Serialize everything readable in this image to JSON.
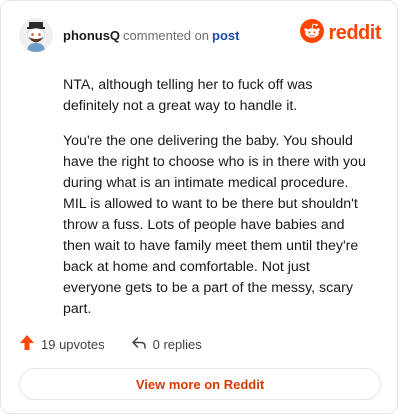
{
  "header": {
    "username": "phonusQ",
    "action_text": "commented on",
    "post_link": "post",
    "brand_name": "reddit",
    "avatar_icon": "snoo-avatar-icon",
    "brand_icon": "reddit-logo-icon"
  },
  "comment": {
    "paragraphs": [
      "NTA, although telling her to fuck off was definitely not a great way to handle it.",
      "You're the one delivering the baby. You should have the right to choose who is in there with you during what is an intimate medical procedure. MIL is allowed to want to be there but shouldn't throw a fuss. Lots of people have babies and then wait to have family meet them until they're back at home and comfortable. Not just everyone gets to be a part of the messy, scary part."
    ]
  },
  "stats": {
    "upvotes_label": "19 upvotes",
    "replies_label": "0 replies",
    "upvote_icon": "upvote-arrow-icon",
    "reply_icon": "reply-arrow-icon"
  },
  "footer": {
    "view_more_label": "View more on Reddit"
  },
  "colors": {
    "brand": "#ff4500",
    "link": "#1a4aa6",
    "cta_text": "#d93a00",
    "border": "#e3e6e8"
  }
}
